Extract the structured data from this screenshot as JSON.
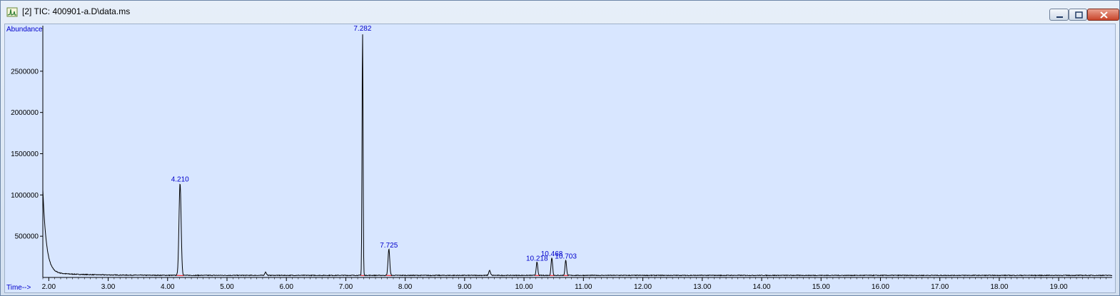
{
  "window": {
    "title": "[2] TIC: 400901-a.D\\data.ms",
    "icons": {
      "app": "chromatogram-app-icon",
      "minimize": "minimize-icon",
      "maximize": "maximize-icon",
      "close": "close-icon"
    },
    "colors": {
      "plot_bg": "#d8e6ff",
      "trace": "#000000",
      "labels": "#0000cc",
      "baseline": "#ff0000"
    }
  },
  "chart_data": {
    "type": "line",
    "ylabel": "Abundance",
    "xlabel": "Time-->",
    "xlim": [
      1.9,
      19.9
    ],
    "ylim": [
      0,
      3000000
    ],
    "xticks": [
      "2.00",
      "3.00",
      "4.00",
      "5.00",
      "6.00",
      "7.00",
      "8.00",
      "9.00",
      "10.00",
      "11.00",
      "12.00",
      "13.00",
      "14.00",
      "15.00",
      "16.00",
      "17.00",
      "18.00",
      "19.00"
    ],
    "yticks": [
      "500000",
      "1000000",
      "1500000",
      "2000000",
      "2500000"
    ],
    "baseline_abundance": 25000,
    "initial_abundance": 1030000,
    "peaks": [
      {
        "label": "4.210",
        "time": 4.21,
        "abundance": 1120000,
        "width": 0.025
      },
      {
        "label": "7.282",
        "time": 7.282,
        "abundance": 2950000,
        "width": 0.012
      },
      {
        "label": "7.725",
        "time": 7.725,
        "abundance": 320000,
        "width": 0.02
      },
      {
        "label": "10.218",
        "time": 10.218,
        "abundance": 160000,
        "width": 0.018
      },
      {
        "label": "10.468",
        "time": 10.468,
        "abundance": 215000,
        "width": 0.018
      },
      {
        "label": "10.703",
        "time": 10.703,
        "abundance": 185000,
        "width": 0.018
      }
    ],
    "minor_peaks": [
      {
        "time": 5.65,
        "abundance": 40000
      },
      {
        "time": 9.42,
        "abundance": 60000
      }
    ]
  }
}
